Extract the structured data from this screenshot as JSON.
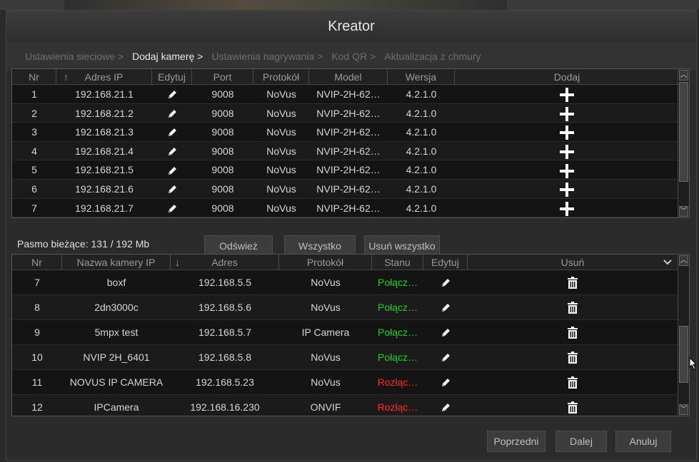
{
  "window": {
    "title": "Kreator"
  },
  "steps": [
    {
      "label": "Ustawienia sieciowe >",
      "active": false
    },
    {
      "label": "Dodaj kamerę >",
      "active": true
    },
    {
      "label": "Ustawienia nagrywania >",
      "active": false
    },
    {
      "label": "Kod QR >",
      "active": false
    },
    {
      "label": "Aktualizacja z chmury",
      "active": false
    }
  ],
  "discovered": {
    "headers": {
      "nr": "Nr",
      "sort_icon": "↑",
      "address": "Adres IP",
      "edit": "Edytuj",
      "port": "Port",
      "protocol": "Protokół",
      "model": "Model",
      "version": "Wersja",
      "add": "Dodaj"
    },
    "rows": [
      {
        "nr": "1",
        "address": "192.168.21.1",
        "port": "9008",
        "protocol": "NoVus",
        "model": "NVIP-2H-62…",
        "version": "4.2.1.0"
      },
      {
        "nr": "2",
        "address": "192.168.21.2",
        "port": "9008",
        "protocol": "NoVus",
        "model": "NVIP-2H-62…",
        "version": "4.2.1.0"
      },
      {
        "nr": "3",
        "address": "192.168.21.3",
        "port": "9008",
        "protocol": "NoVus",
        "model": "NVIP-2H-62…",
        "version": "4.2.1.0"
      },
      {
        "nr": "4",
        "address": "192.168.21.4",
        "port": "9008",
        "protocol": "NoVus",
        "model": "NVIP-2H-62…",
        "version": "4.2.1.0"
      },
      {
        "nr": "5",
        "address": "192.168.21.5",
        "port": "9008",
        "protocol": "NoVus",
        "model": "NVIP-2H-62…",
        "version": "4.2.1.0"
      },
      {
        "nr": "6",
        "address": "192.168.21.6",
        "port": "9008",
        "protocol": "NoVus",
        "model": "NVIP-2H-62…",
        "version": "4.2.1.0"
      },
      {
        "nr": "7",
        "address": "192.168.21.7",
        "port": "9008",
        "protocol": "NoVus",
        "model": "NVIP-2H-62…",
        "version": "4.2.1.0"
      }
    ]
  },
  "bandwidth": {
    "label": "Pasmo bieżące: 131 / 192 Mb"
  },
  "middle_buttons": {
    "refresh": "Odśwież",
    "all": "Wszystko",
    "remove_all": "Usuń wszystko"
  },
  "added": {
    "headers": {
      "nr": "Nr",
      "name": "Nazwa kamery IP",
      "sort_icon": "↓",
      "address": "Adres",
      "protocol": "Protokół",
      "status": "Stanu",
      "edit": "Edytuj",
      "remove": "Usuń"
    },
    "rows": [
      {
        "nr": "7",
        "name": "boxf",
        "address": "192.168.5.5",
        "protocol": "NoVus",
        "status": "Połącz…",
        "status_color": "green"
      },
      {
        "nr": "8",
        "name": "2dn3000c",
        "address": "192.168.5.6",
        "protocol": "NoVus",
        "status": "Połącz…",
        "status_color": "green"
      },
      {
        "nr": "9",
        "name": "5mpx test",
        "address": "192.168.5.7",
        "protocol": "IP Camera",
        "status": "Połącz…",
        "status_color": "green"
      },
      {
        "nr": "10",
        "name": "NVIP 2H_6401",
        "address": "192.168.5.8",
        "protocol": "NoVus",
        "status": "Połącz…",
        "status_color": "green"
      },
      {
        "nr": "11",
        "name": "NOVUS IP CAMERA",
        "address": "192.168.5.23",
        "protocol": "NoVus",
        "status": "Rozłąc…",
        "status_color": "red"
      },
      {
        "nr": "12",
        "name": "IPCamera",
        "address": "192.168.16.230",
        "protocol": "ONVIF",
        "status": "Rozłąc…",
        "status_color": "red"
      }
    ]
  },
  "footer": {
    "prev": "Poprzedni",
    "next": "Dalej",
    "cancel": "Anuluj"
  },
  "colors": {
    "connected": "#22d02a",
    "disconnected": "#ff2a2a"
  }
}
